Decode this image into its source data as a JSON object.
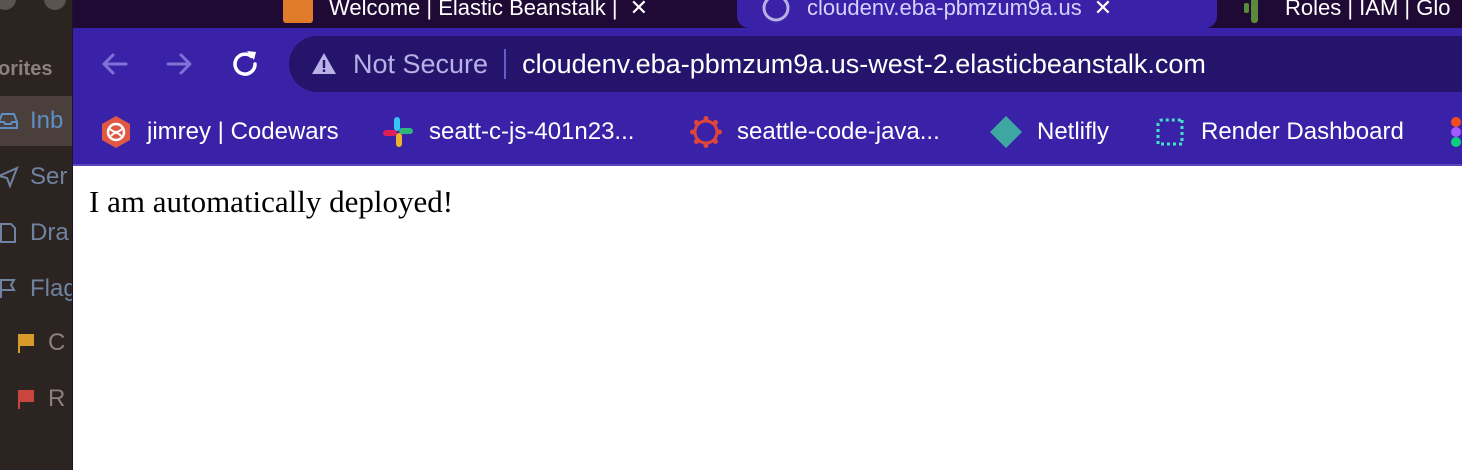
{
  "mail": {
    "section_label": "orites",
    "items": [
      {
        "label": "Inb",
        "icon": "inbox-icon"
      },
      {
        "label": "Ser",
        "icon": "sent-icon"
      },
      {
        "label": "Dra",
        "icon": "draft-icon"
      },
      {
        "label": "Flag",
        "icon": "flag-outline-icon"
      },
      {
        "label": "C",
        "icon": "orange-flag-icon"
      },
      {
        "label": "R",
        "icon": "red-flag-icon"
      }
    ]
  },
  "tabs": [
    {
      "title": "Welcome | Elastic Beanstalk | ",
      "icon": "aws-icon",
      "active": false
    },
    {
      "title": "cloudenv.eba-pbmzum9a.us",
      "icon": "globe-icon",
      "active": true
    },
    {
      "title": "Roles | IAM | Glo",
      "icon": "cactus-icon",
      "active": false
    }
  ],
  "address_bar": {
    "security_label": "Not Secure",
    "url": "cloudenv.eba-pbmzum9a.us-west-2.elasticbeanstalk.com"
  },
  "bookmarks": [
    {
      "label": "jimrey | Codewars",
      "icon": "codewars-icon"
    },
    {
      "label": "seatt-c-js-401n23...",
      "icon": "slack-icon"
    },
    {
      "label": "seattle-code-java...",
      "icon": "canvas-icon"
    },
    {
      "label": "Netlifly",
      "icon": "netlify-icon"
    },
    {
      "label": "Render Dashboard",
      "icon": "render-icon"
    }
  ],
  "page": {
    "text": "I am automatically deployed!"
  },
  "colors": {
    "toolbar": "#3a22a8",
    "tabstrip": "#1f0a35",
    "omnibox": "#24146b"
  }
}
